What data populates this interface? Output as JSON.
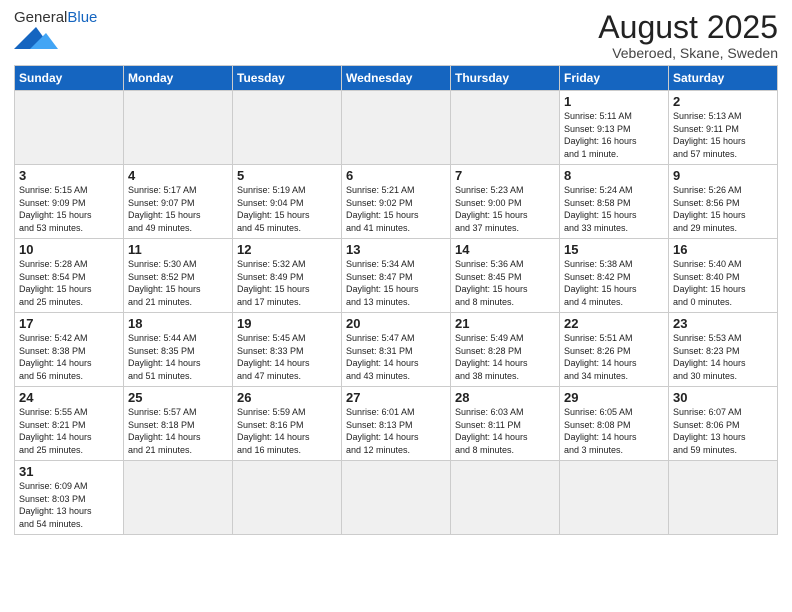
{
  "header": {
    "logo_general": "General",
    "logo_blue": "Blue",
    "month_title": "August 2025",
    "location": "Veberoed, Skane, Sweden"
  },
  "weekdays": [
    "Sunday",
    "Monday",
    "Tuesday",
    "Wednesday",
    "Thursday",
    "Friday",
    "Saturday"
  ],
  "weeks": [
    [
      {
        "day": "",
        "info": ""
      },
      {
        "day": "",
        "info": ""
      },
      {
        "day": "",
        "info": ""
      },
      {
        "day": "",
        "info": ""
      },
      {
        "day": "",
        "info": ""
      },
      {
        "day": "1",
        "info": "Sunrise: 5:11 AM\nSunset: 9:13 PM\nDaylight: 16 hours\nand 1 minute."
      },
      {
        "day": "2",
        "info": "Sunrise: 5:13 AM\nSunset: 9:11 PM\nDaylight: 15 hours\nand 57 minutes."
      }
    ],
    [
      {
        "day": "3",
        "info": "Sunrise: 5:15 AM\nSunset: 9:09 PM\nDaylight: 15 hours\nand 53 minutes."
      },
      {
        "day": "4",
        "info": "Sunrise: 5:17 AM\nSunset: 9:07 PM\nDaylight: 15 hours\nand 49 minutes."
      },
      {
        "day": "5",
        "info": "Sunrise: 5:19 AM\nSunset: 9:04 PM\nDaylight: 15 hours\nand 45 minutes."
      },
      {
        "day": "6",
        "info": "Sunrise: 5:21 AM\nSunset: 9:02 PM\nDaylight: 15 hours\nand 41 minutes."
      },
      {
        "day": "7",
        "info": "Sunrise: 5:23 AM\nSunset: 9:00 PM\nDaylight: 15 hours\nand 37 minutes."
      },
      {
        "day": "8",
        "info": "Sunrise: 5:24 AM\nSunset: 8:58 PM\nDaylight: 15 hours\nand 33 minutes."
      },
      {
        "day": "9",
        "info": "Sunrise: 5:26 AM\nSunset: 8:56 PM\nDaylight: 15 hours\nand 29 minutes."
      }
    ],
    [
      {
        "day": "10",
        "info": "Sunrise: 5:28 AM\nSunset: 8:54 PM\nDaylight: 15 hours\nand 25 minutes."
      },
      {
        "day": "11",
        "info": "Sunrise: 5:30 AM\nSunset: 8:52 PM\nDaylight: 15 hours\nand 21 minutes."
      },
      {
        "day": "12",
        "info": "Sunrise: 5:32 AM\nSunset: 8:49 PM\nDaylight: 15 hours\nand 17 minutes."
      },
      {
        "day": "13",
        "info": "Sunrise: 5:34 AM\nSunset: 8:47 PM\nDaylight: 15 hours\nand 13 minutes."
      },
      {
        "day": "14",
        "info": "Sunrise: 5:36 AM\nSunset: 8:45 PM\nDaylight: 15 hours\nand 8 minutes."
      },
      {
        "day": "15",
        "info": "Sunrise: 5:38 AM\nSunset: 8:42 PM\nDaylight: 15 hours\nand 4 minutes."
      },
      {
        "day": "16",
        "info": "Sunrise: 5:40 AM\nSunset: 8:40 PM\nDaylight: 15 hours\nand 0 minutes."
      }
    ],
    [
      {
        "day": "17",
        "info": "Sunrise: 5:42 AM\nSunset: 8:38 PM\nDaylight: 14 hours\nand 56 minutes."
      },
      {
        "day": "18",
        "info": "Sunrise: 5:44 AM\nSunset: 8:35 PM\nDaylight: 14 hours\nand 51 minutes."
      },
      {
        "day": "19",
        "info": "Sunrise: 5:45 AM\nSunset: 8:33 PM\nDaylight: 14 hours\nand 47 minutes."
      },
      {
        "day": "20",
        "info": "Sunrise: 5:47 AM\nSunset: 8:31 PM\nDaylight: 14 hours\nand 43 minutes."
      },
      {
        "day": "21",
        "info": "Sunrise: 5:49 AM\nSunset: 8:28 PM\nDaylight: 14 hours\nand 38 minutes."
      },
      {
        "day": "22",
        "info": "Sunrise: 5:51 AM\nSunset: 8:26 PM\nDaylight: 14 hours\nand 34 minutes."
      },
      {
        "day": "23",
        "info": "Sunrise: 5:53 AM\nSunset: 8:23 PM\nDaylight: 14 hours\nand 30 minutes."
      }
    ],
    [
      {
        "day": "24",
        "info": "Sunrise: 5:55 AM\nSunset: 8:21 PM\nDaylight: 14 hours\nand 25 minutes."
      },
      {
        "day": "25",
        "info": "Sunrise: 5:57 AM\nSunset: 8:18 PM\nDaylight: 14 hours\nand 21 minutes."
      },
      {
        "day": "26",
        "info": "Sunrise: 5:59 AM\nSunset: 8:16 PM\nDaylight: 14 hours\nand 16 minutes."
      },
      {
        "day": "27",
        "info": "Sunrise: 6:01 AM\nSunset: 8:13 PM\nDaylight: 14 hours\nand 12 minutes."
      },
      {
        "day": "28",
        "info": "Sunrise: 6:03 AM\nSunset: 8:11 PM\nDaylight: 14 hours\nand 8 minutes."
      },
      {
        "day": "29",
        "info": "Sunrise: 6:05 AM\nSunset: 8:08 PM\nDaylight: 14 hours\nand 3 minutes."
      },
      {
        "day": "30",
        "info": "Sunrise: 6:07 AM\nSunset: 8:06 PM\nDaylight: 13 hours\nand 59 minutes."
      }
    ],
    [
      {
        "day": "31",
        "info": "Sunrise: 6:09 AM\nSunset: 8:03 PM\nDaylight: 13 hours\nand 54 minutes."
      },
      {
        "day": "",
        "info": ""
      },
      {
        "day": "",
        "info": ""
      },
      {
        "day": "",
        "info": ""
      },
      {
        "day": "",
        "info": ""
      },
      {
        "day": "",
        "info": ""
      },
      {
        "day": "",
        "info": ""
      }
    ]
  ]
}
